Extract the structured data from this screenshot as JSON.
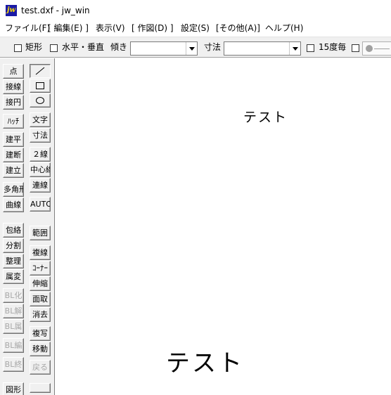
{
  "window": {
    "icon_text": "jw",
    "title": "test.dxf - jw_win"
  },
  "menu": [
    "ファイル(F)",
    "[ 編集(E) ]",
    "表示(V)",
    "[ 作図(D) ]",
    "設定(S)",
    "[その他(A)]",
    "ヘルプ(H)"
  ],
  "toolbar": {
    "rect_label": "矩形",
    "hv_label": "水平・垂直",
    "tilt_label": "傾き",
    "tilt_value": "",
    "dim_label": "寸法",
    "dim_value": "",
    "step15_label": "15度毎"
  },
  "left_tools": {
    "col1": [
      "点",
      "接線",
      "接円",
      "ﾊｯﾁ",
      "建平",
      "建断",
      "建立",
      "多角形",
      "曲線",
      "包絡",
      "分割",
      "整理",
      "属変",
      "BL化",
      "BL解",
      "BL属",
      "BL編",
      "BL終",
      "図形"
    ],
    "col2": [
      "文字",
      "寸法",
      "２線",
      "中心線",
      "連線",
      "AUTO",
      "範囲",
      "複線",
      "ｺｰﾅｰ",
      "伸縮",
      "面取",
      "消去",
      "複写",
      "移動",
      "戻る"
    ],
    "icons": [
      "line-icon",
      "rectangle-icon",
      "circle-icon"
    ]
  },
  "canvas": {
    "text_small": "テスト",
    "text_large": "テスト"
  }
}
